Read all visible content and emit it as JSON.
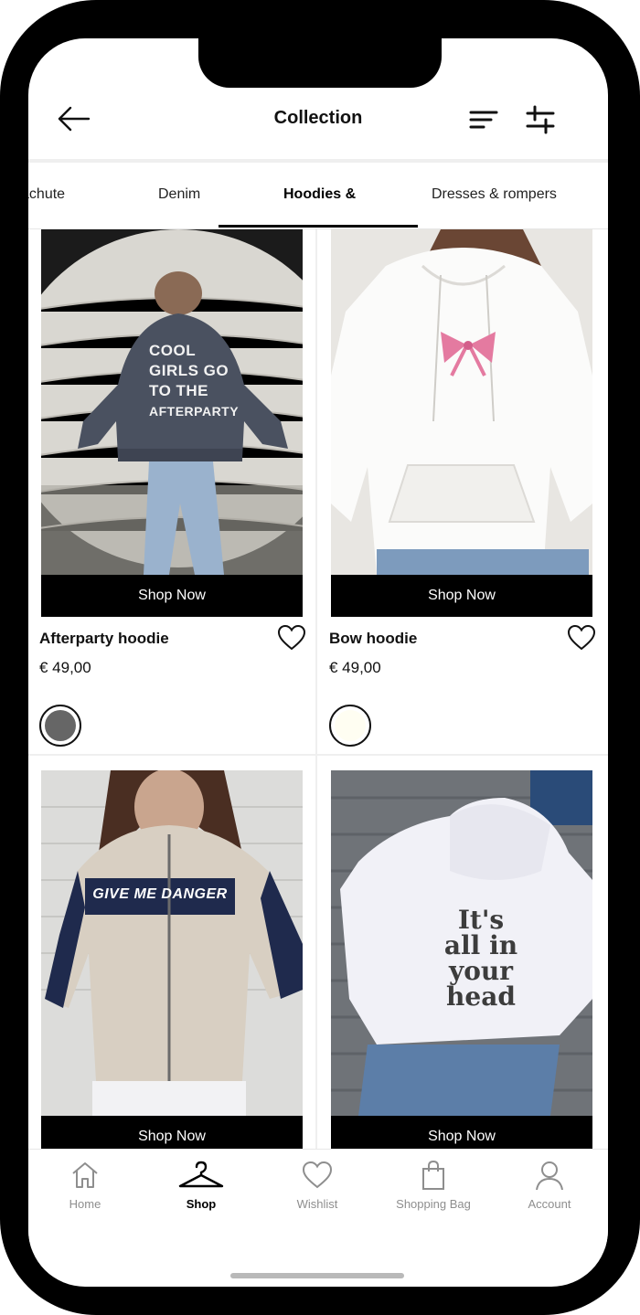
{
  "header": {
    "title": "Collection"
  },
  "tabs": [
    {
      "label": "Cargo & Parachute",
      "visible_label": "Parachute"
    },
    {
      "label": "Denim"
    },
    {
      "label": "Hoodies &"
    },
    {
      "label": "Dresses & rompers"
    }
  ],
  "active_tab": "Hoodies &",
  "products": [
    {
      "name": "Afterparty hoodie",
      "price": "€ 49,00",
      "cta": "Shop Now",
      "print_lines": [
        "COOL",
        "GIRLS GO",
        "TO THE",
        "AFTERPARTY"
      ],
      "swatch_color": "#666666"
    },
    {
      "name": "Bow hoodie",
      "price": "€ 49,00",
      "cta": "Shop Now",
      "swatch_color": "#fffef2"
    },
    {
      "name": "",
      "cta": "Shop Now",
      "print_lines": [
        "GIVE ME DANGER"
      ]
    },
    {
      "name": "",
      "cta": "Shop Now",
      "print_lines": [
        "It's",
        "all in",
        "your",
        "head"
      ]
    }
  ],
  "bottom_nav": {
    "items": [
      {
        "label": "Home",
        "icon": "home-icon"
      },
      {
        "label": "Shop",
        "icon": "hanger-icon"
      },
      {
        "label": "Wishlist",
        "icon": "heart-icon"
      },
      {
        "label": "Shopping Bag",
        "icon": "shopping-bag-icon"
      },
      {
        "label": "Account",
        "icon": "user-icon"
      }
    ],
    "active": "Shop"
  },
  "colors": {
    "accent": "#000000",
    "inactive_nav": "#8e8e8e",
    "background": "#ffffff"
  }
}
